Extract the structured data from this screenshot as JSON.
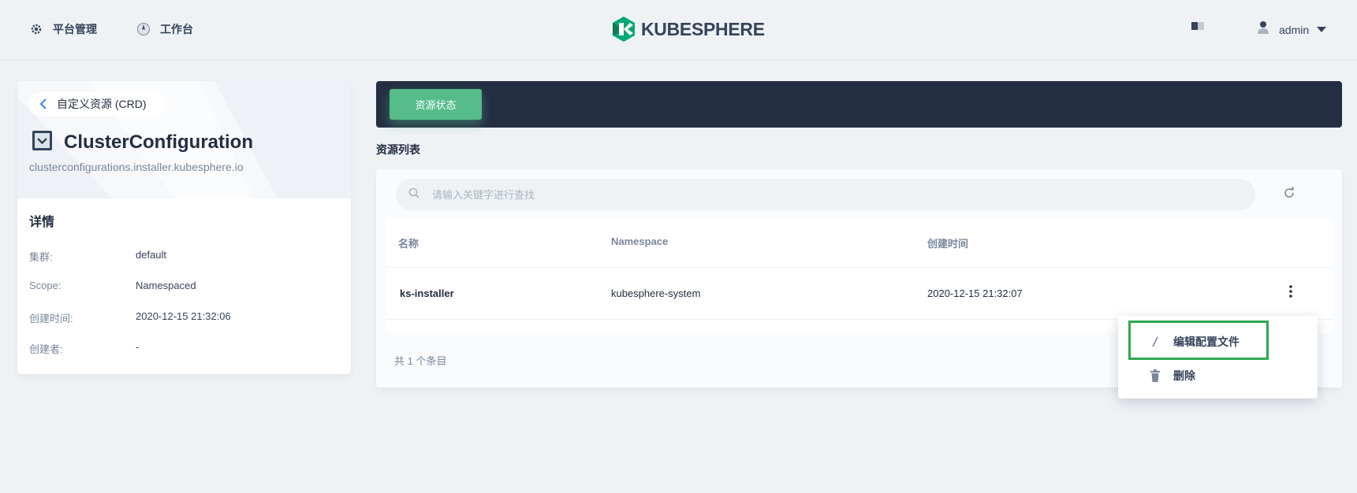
{
  "topbar": {
    "platform_label": "平台管理",
    "workbench_label": "工作台",
    "logo_text": "KUBESPHERE",
    "user_name": "admin"
  },
  "crd": {
    "back_label": "自定义资源 (CRD)",
    "title": "ClusterConfiguration",
    "subtitle": "clusterconfigurations.installer.kubesphere.io"
  },
  "details": {
    "heading": "详情",
    "rows": [
      {
        "key": "集群:",
        "value": "default"
      },
      {
        "key": "Scope:",
        "value": "Namespaced"
      },
      {
        "key": "创建时间:",
        "value": "2020-12-15 21:32:06"
      },
      {
        "key": "创建者:",
        "value": "-"
      }
    ]
  },
  "banner": {
    "status_tab": "资源状态"
  },
  "list": {
    "section_label": "资源列表",
    "search_placeholder": "请输入关键字进行查找",
    "columns": [
      "名称",
      "Namespace",
      "创建时间"
    ],
    "rows": [
      {
        "name": "ks-installer",
        "namespace": "kubesphere-system",
        "created": "2020-12-15 21:32:07"
      }
    ],
    "total": "共 1 个条目"
  },
  "menu": {
    "items": [
      {
        "label": "编辑配置文件",
        "icon": "pencil-icon"
      },
      {
        "label": "删除",
        "icon": "trash-icon"
      }
    ]
  },
  "colors": {
    "accent_green": "#55bc8a",
    "dark_banner": "#242e42",
    "highlight_green": "#2ea84f",
    "back_chevron": "#3385ff"
  }
}
